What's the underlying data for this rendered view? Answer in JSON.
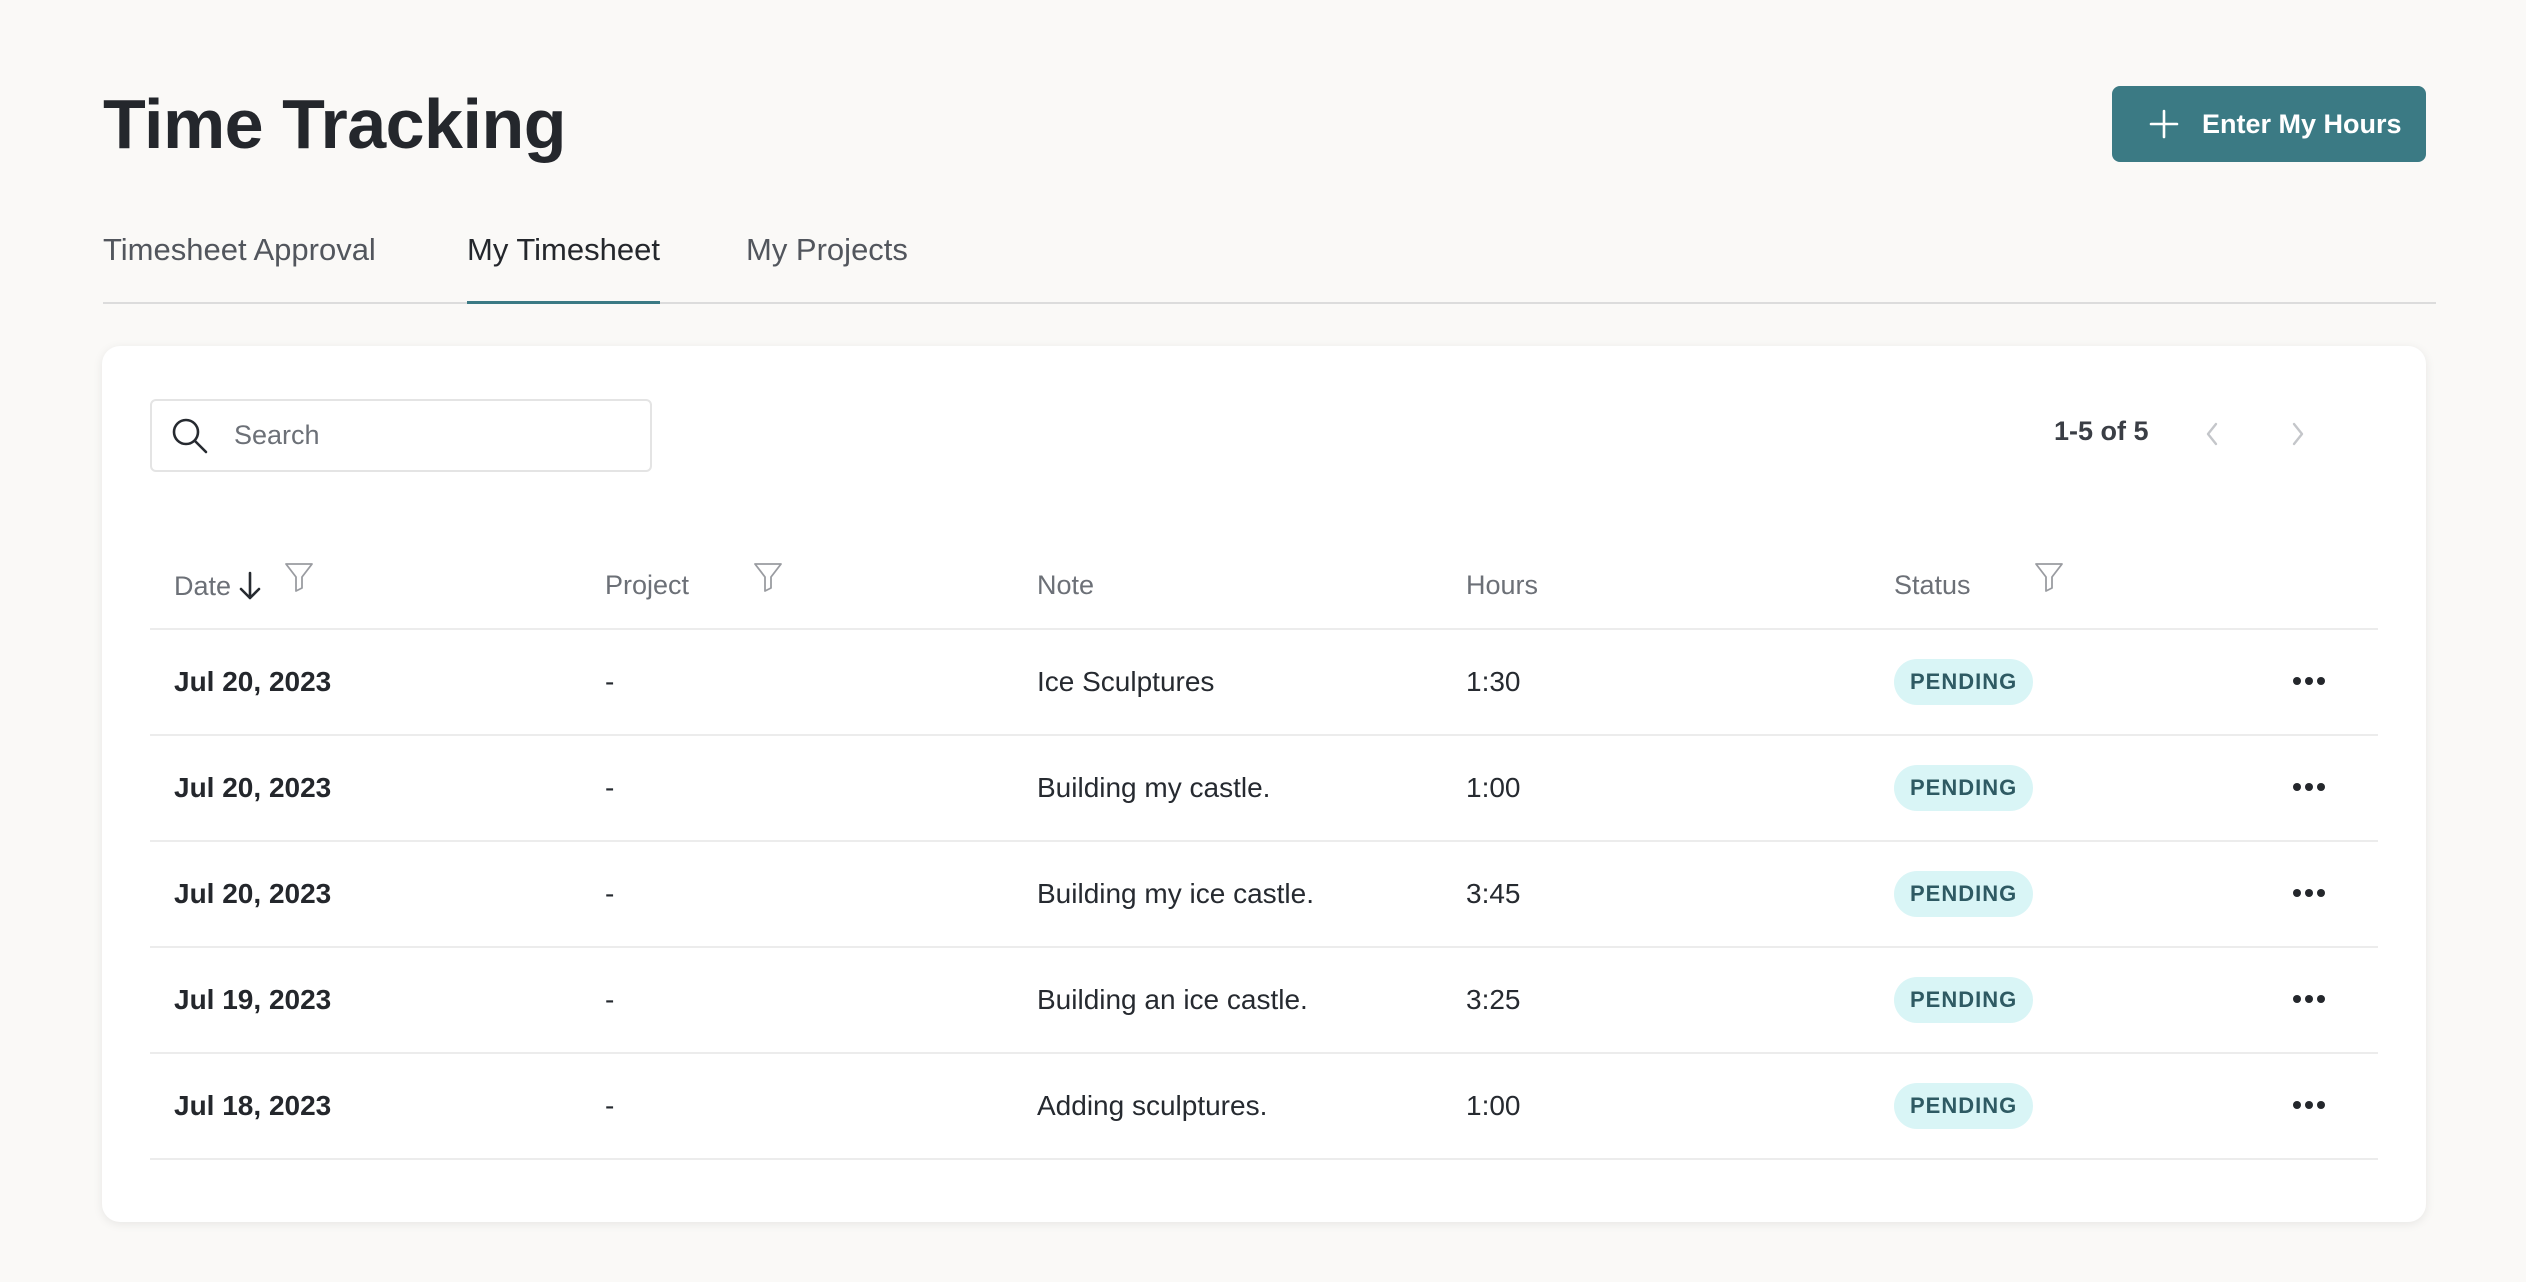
{
  "page": {
    "title": "Time Tracking"
  },
  "actions": {
    "enter_hours_label": "Enter My Hours"
  },
  "tabs": [
    {
      "label": "Timesheet Approval",
      "active": false
    },
    {
      "label": "My Timesheet",
      "active": true
    },
    {
      "label": "My Projects",
      "active": false
    }
  ],
  "search": {
    "placeholder": "Search",
    "value": ""
  },
  "pagination": {
    "label": "1-5 of 5"
  },
  "table": {
    "columns": {
      "date": "Date",
      "project": "Project",
      "note": "Note",
      "hours": "Hours",
      "status": "Status"
    },
    "rows": [
      {
        "date": "Jul 20, 2023",
        "project": "-",
        "note": "Ice Sculptures",
        "hours": "1:30",
        "status": "PENDING"
      },
      {
        "date": "Jul 20, 2023",
        "project": "-",
        "note": "Building my castle.",
        "hours": "1:00",
        "status": "PENDING"
      },
      {
        "date": "Jul 20, 2023",
        "project": "-",
        "note": "Building my ice castle.",
        "hours": "3:45",
        "status": "PENDING"
      },
      {
        "date": "Jul 19, 2023",
        "project": "-",
        "note": "Building an ice castle.",
        "hours": "3:25",
        "status": "PENDING"
      },
      {
        "date": "Jul 18, 2023",
        "project": "-",
        "note": "Adding sculptures.",
        "hours": "1:00",
        "status": "PENDING"
      }
    ]
  },
  "icons": {
    "add": "plus-icon",
    "search": "search-icon",
    "sort": "arrow-down-icon",
    "filter": "filter-icon",
    "prev": "chevron-left-icon",
    "next": "chevron-right-icon",
    "row_menu": "more-horizontal-icon"
  },
  "colors": {
    "background": "#faf9f7",
    "primary": "#3b7a84",
    "badge_bg": "#d9f5f6",
    "badge_text": "#2e5a63"
  }
}
